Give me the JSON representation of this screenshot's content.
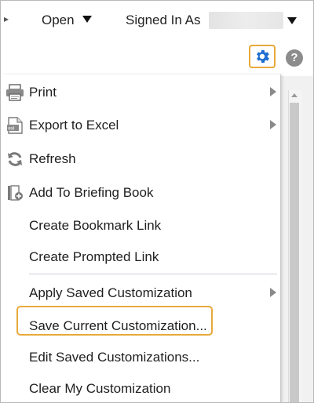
{
  "topbar": {
    "open_label": "Open",
    "signed_in_label": "Signed In As"
  },
  "toolbar": {
    "settings_icon": "gear-icon",
    "help_icon": "help-icon",
    "help_glyph": "?",
    "accent_color": "#e8a93a",
    "gear_color": "#1f6fd1"
  },
  "menu": {
    "items": [
      {
        "label": "Print",
        "icon": "printer-icon",
        "submenu": true
      },
      {
        "label": "Export to Excel",
        "icon": "excel-icon",
        "submenu": true
      },
      {
        "label": "Refresh",
        "icon": "refresh-icon",
        "submenu": false
      },
      {
        "label": "Add To Briefing Book",
        "icon": "briefing-book-icon",
        "submenu": false
      },
      {
        "label": "Create Bookmark Link",
        "icon": "",
        "submenu": false
      },
      {
        "label": "Create Prompted Link",
        "icon": "",
        "submenu": false
      },
      {
        "label": "Apply Saved Customization",
        "icon": "",
        "submenu": true
      },
      {
        "label": "Save Current Customization...",
        "icon": "",
        "submenu": false,
        "highlighted": true
      },
      {
        "label": "Edit Saved Customizations...",
        "icon": "",
        "submenu": false
      },
      {
        "label": "Clear My Customization",
        "icon": "",
        "submenu": false
      }
    ]
  }
}
